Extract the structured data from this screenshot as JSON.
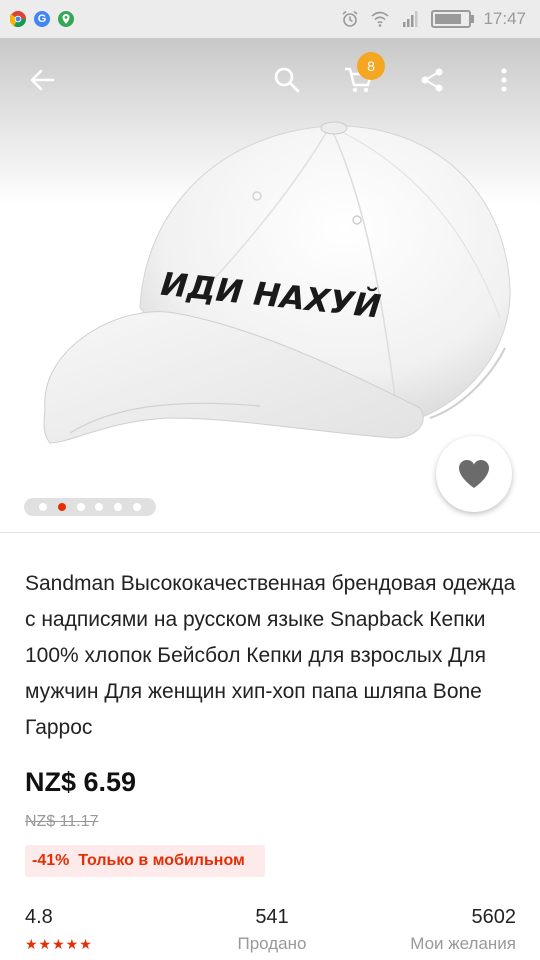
{
  "status_bar": {
    "apps": [
      {
        "icon": "chrome-icon",
        "color": "#e8453c",
        "letter": ""
      },
      {
        "icon": "google-icon",
        "color": "#4285f4",
        "letter": "G"
      },
      {
        "icon": "maps-icon",
        "color": "#34a853",
        "letter": ""
      }
    ],
    "time": "17:47"
  },
  "toolbar": {
    "cart_count": "8"
  },
  "product_image": {
    "cap_text": "ИДИ НАХУЙ",
    "pager_total": 6,
    "pager_active": 1
  },
  "product": {
    "title": "Sandman Высококачественная брендовая одежда с надписями на русском языке Snapback Кепки 100% хлопок Бейсбол Кепки для взрослых Для мужчин Для женщин хип-хоп папа шляпа Bone Гаррос",
    "price": "NZ$ 6.59",
    "old_price": "NZ$ 11.17",
    "promo": "-41%  Только в мобильном"
  },
  "stats": {
    "rating": "4.8",
    "stars": "★★★★★",
    "sold_value": "541",
    "sold_label": "Продано",
    "wishlist_value": "5602",
    "wishlist_label": "Мои желания"
  },
  "colors": {
    "accent": "#e62e04",
    "badge": "#f5a623"
  }
}
